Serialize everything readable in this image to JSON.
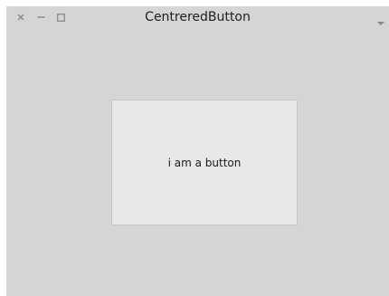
{
  "window": {
    "title": "CentreredButton",
    "controls": {
      "close_icon": "close-icon",
      "minimize_icon": "minimize-icon",
      "maximize_icon": "maximize-icon",
      "menu_icon": "chevron-down-icon"
    }
  },
  "main": {
    "button_label": "i am a button"
  },
  "colors": {
    "window_bg": "#d5d5d5",
    "button_bg": "#e8e8e8",
    "button_border": "#c8c8c8",
    "control_color": "#8a8a8a"
  }
}
